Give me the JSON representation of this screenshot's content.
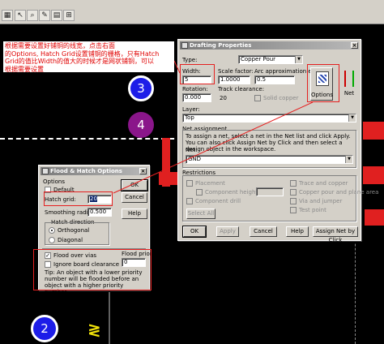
{
  "annotation": {
    "text": "根据需要设置好铺铜的线宽，点击右面\n的Options, Hatch Grid设置铺铜的栅格，只有Hatch\nGrid的值比Width的值大的时候才是网状铺铜，可以\n根据需要设置"
  },
  "pads": [
    "3",
    "4",
    "2"
  ],
  "drafting": {
    "title": "Drafting Properties",
    "type_label": "Type:",
    "type_value": "Copper Pour",
    "width_label": "Width:",
    "width_value": "5",
    "scale_label": "Scale factor:",
    "scale_value": "1.0000",
    "arc_label": "Arc approximation error:",
    "arc_value": "0.5",
    "rotation_label": "Rotation:",
    "rotation_value": "0.000",
    "track_clear_label": "Track clearance:",
    "track_clear_value": "20",
    "solid_copper": "Solid copper",
    "options_btn": "Options",
    "net_btn": "Net",
    "layer_label": "Layer:",
    "layer_value": "Top",
    "net_assign_label": "Net assignment",
    "net_assign_text": "To assign a net, select a net in the Net list and click Apply. You can also click Assign Net by Click and then select a design object in the workspace.",
    "net_label": "Net:",
    "net_value": "GND",
    "restrictions_label": "Restrictions",
    "restr": {
      "placement": "Placement",
      "component_height": "Component height:",
      "component_drill": "Component drill",
      "trace_copper": "Trace and copper",
      "copper_board": "Copper pour and plane area",
      "via_jumper": "Via and jumper",
      "test_point": "Test point",
      "select_all": "Select All"
    },
    "ok": "OK",
    "apply": "Apply",
    "cancel": "Cancel",
    "help": "Help",
    "assign_net": "Assign Net by Click"
  },
  "flood": {
    "title": "Flood & Hatch Options",
    "options_label": "Options",
    "default_label": "Default",
    "hatch_grid_label": "Hatch grid:",
    "hatch_grid_value": "20",
    "smoothing_label": "Smoothing radius:",
    "smoothing_value": "0.500",
    "hatch_dir_label": "Hatch direction",
    "orthogonal": "Orthogonal",
    "diagonal": "Diagonal",
    "flood_vias": "Flood over vias",
    "ignore_board": "Ignore board clearance",
    "flood_priority_label": "Flood priority:",
    "flood_priority_value": "0",
    "tip": "Tip: An object with a lower priority number will be flooded before an object with a higher priority number",
    "ok": "OK",
    "cancel": "Cancel",
    "help": "Help"
  },
  "colors": {
    "annotation_red": "#e00000",
    "pad_blue": "#1d1de8",
    "pad_purple": "#8a168a",
    "trace_red": "#e02020",
    "selection": "#0a246a"
  }
}
